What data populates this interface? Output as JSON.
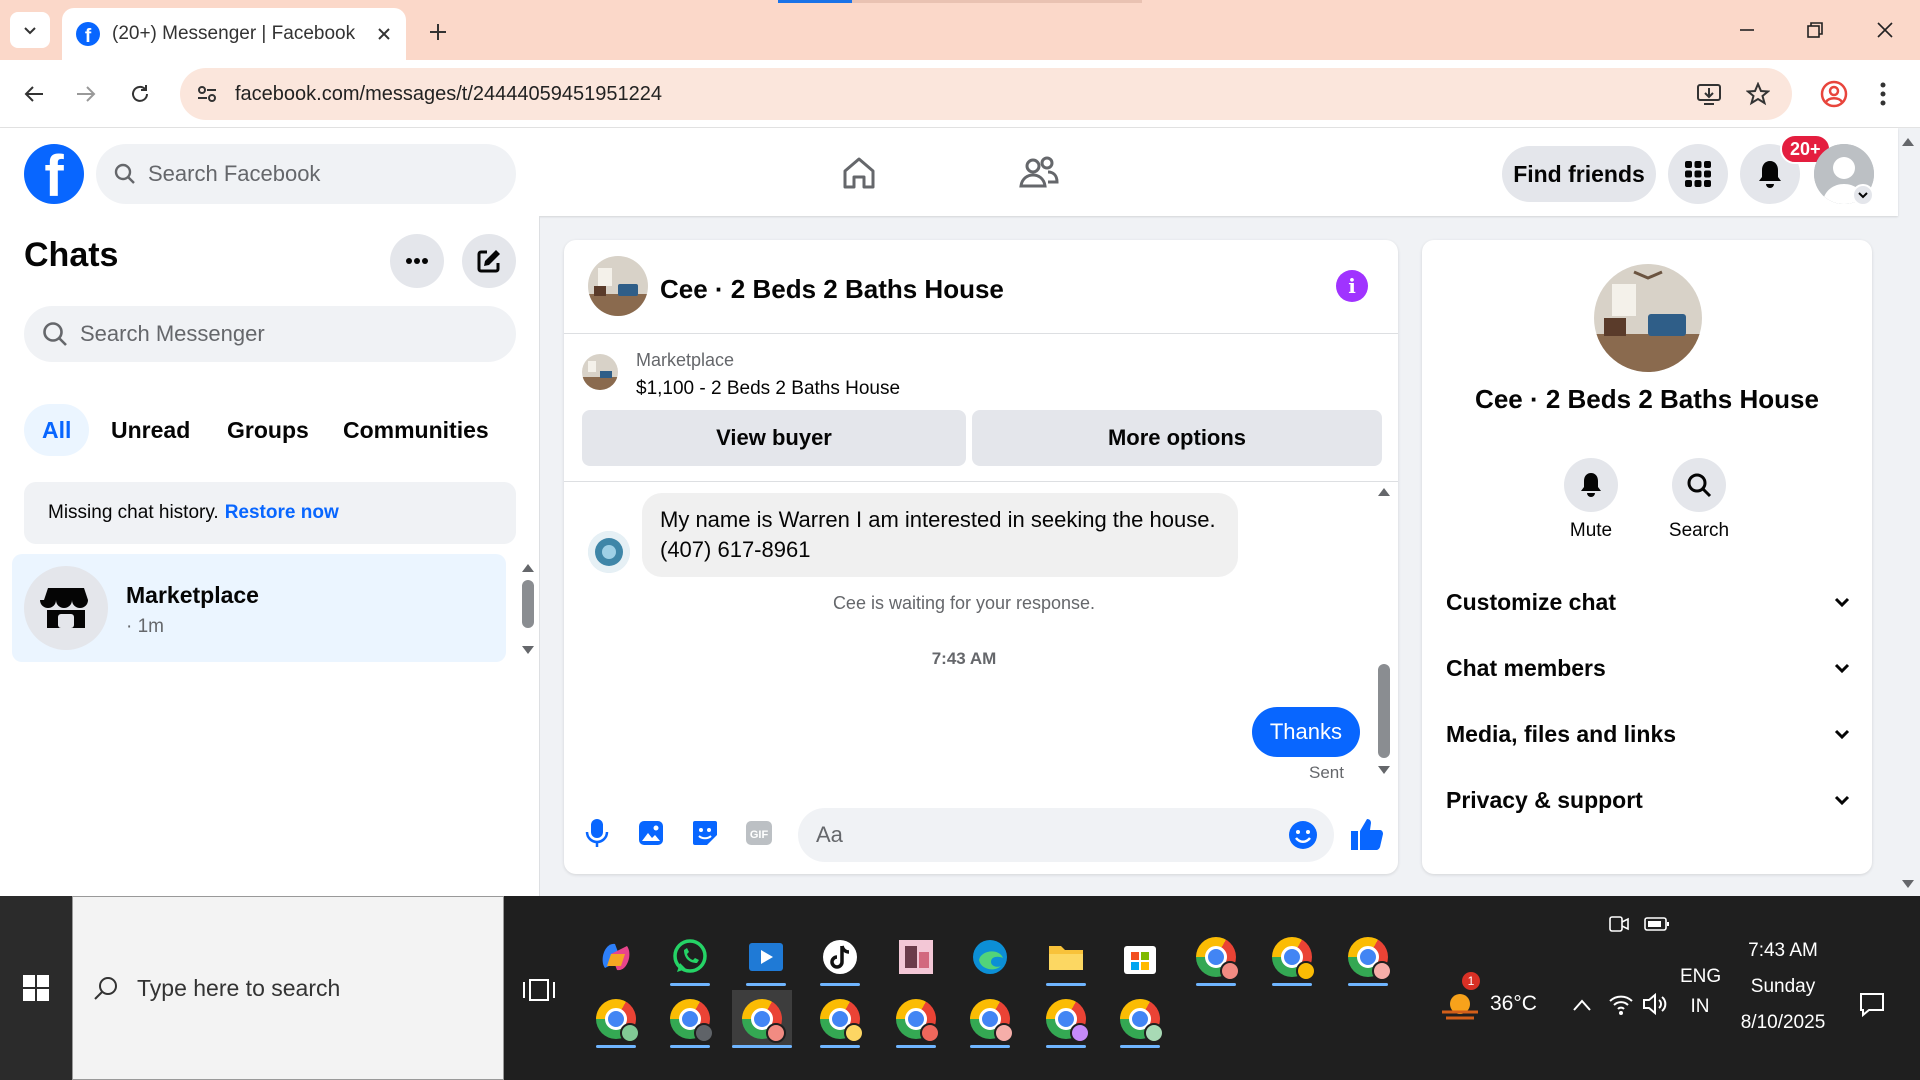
{
  "browser": {
    "tab_title": "(20+) Messenger | Facebook",
    "url": "facebook.com/messages/t/24444059451951224"
  },
  "fb": {
    "search_placeholder": "Search Facebook",
    "find_friends": "Find friends",
    "notification_count": "20+"
  },
  "chats": {
    "title": "Chats",
    "search_placeholder": "Search Messenger",
    "filters": [
      "All",
      "Unread",
      "Groups",
      "Communities"
    ],
    "active_filter": "All",
    "missing_text": "Missing chat history.",
    "restore_link": "Restore now",
    "items": [
      {
        "name": "Marketplace",
        "time": "· 1m"
      }
    ]
  },
  "conversation": {
    "title": "Cee · 2 Beds 2 Baths House",
    "listing_label": "Marketplace",
    "listing_desc": "$1,100 - 2 Beds 2 Baths House",
    "view_buyer": "View buyer",
    "more_options": "More options",
    "incoming_message": "My name is Warren I am interested in seeking the house. (407) 617-8961",
    "waiting_text": "Cee is waiting for your response.",
    "time_separator": "7:43 AM",
    "outgoing_message": "Thanks",
    "sent_label": "Sent",
    "composer_placeholder": "Aa"
  },
  "info_panel": {
    "name": "Cee · 2 Beds 2 Baths House",
    "actions": [
      "Mute",
      "Search"
    ],
    "sections": [
      "Customize chat",
      "Chat members",
      "Media, files and links",
      "Privacy & support"
    ]
  },
  "taskbar": {
    "search_placeholder": "Type here to search",
    "weather_temp": "36°C",
    "weather_badge": "1",
    "language_line1": "ENG",
    "language_line2": "IN",
    "clock_time": "7:43 AM",
    "clock_day": "Sunday",
    "clock_date": "8/10/2025"
  },
  "colors": {
    "fb_blue": "#0866ff",
    "tab_bar": "#fbd8c9",
    "info_purple": "#a033ff",
    "badge_red": "#e41e3f"
  }
}
